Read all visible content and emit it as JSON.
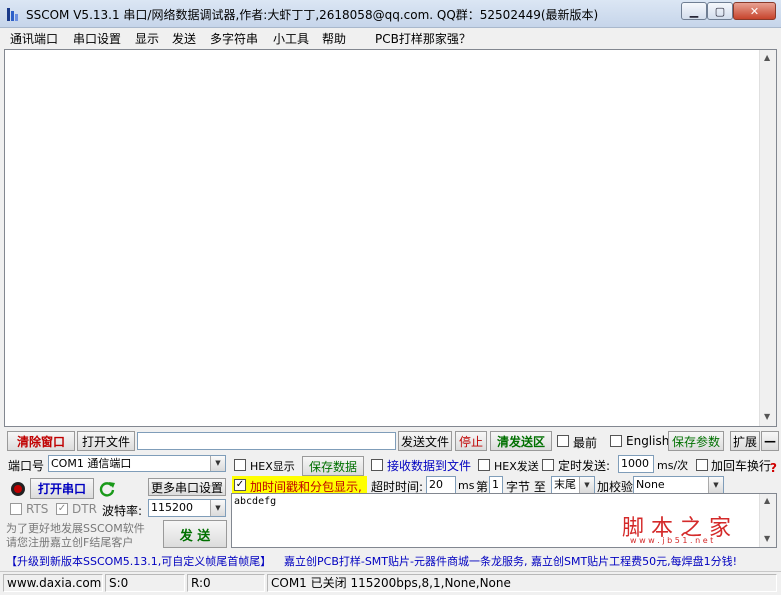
{
  "window": {
    "title": "SSCOM V5.13.1 串口/网络数据调试器,作者:大虾丁丁,2618058@qq.com. QQ群：52502449(最新版本)",
    "minimize": "▁",
    "maximize": "▢",
    "close": "✕"
  },
  "menu": [
    "通讯端口",
    "串口设置",
    "显示",
    "发送",
    "多字符串",
    "小工具",
    "帮助",
    "PCB打样那家强？"
  ],
  "receive": {
    "text": ""
  },
  "toolbar": {
    "clear_window": "清除窗口",
    "open_file": "打开文件",
    "file_path": "",
    "send_file": "发送文件",
    "stop": "停止",
    "clear_send": "清发送区",
    "topmost": "最前",
    "english": "English",
    "save_params": "保存参数",
    "expand": "扩展",
    "collapse": "—"
  },
  "port": {
    "label": "端口号",
    "value": "COM1 通信端口",
    "open_button": "打开串口",
    "more_settings": "更多串口设置",
    "rts": "RTS",
    "dtr": "DTR",
    "baud_label": "波特率:",
    "baud_value": "115200"
  },
  "options": {
    "hex_display": "HEX显示",
    "save_data": "保存数据",
    "recv_to_file": "接收数据到文件",
    "hex_send": "HEX发送",
    "timed_send": "定时发送:",
    "interval": "1000",
    "interval_unit": "ms/次",
    "add_crlf": "加回车换行",
    "help_mark": "?",
    "timestamp": "加时间戳和分包显示,",
    "timeout_label": "超时时间:",
    "timeout_value": "20",
    "timeout_unit": "ms",
    "byte_label_1": "第",
    "byte_index": "1",
    "byte_label_2": "字节 至",
    "byte_end": "末尾",
    "checksum_label": "加校验",
    "checksum_value": "None"
  },
  "promo": {
    "line1": "为了更好地发展SSCOM软件",
    "line2": "请您注册嘉立创F结尾客户",
    "send_button": "发 送"
  },
  "send": {
    "text": "abcdefg"
  },
  "watermark": {
    "cn": "脚 本 之 家",
    "url": "w w w . j b 5 1 . n e t"
  },
  "ticker": {
    "left": "【升级到新版本SSCOM5.13.1,可自定义帧尾首帧尾】",
    "right": "嘉立创PCB打样-SMT贴片-元器件商城一条龙服务, 嘉立创SMT贴片工程费50元,每焊盘1分钱!"
  },
  "status": {
    "site": "www.daxia.com",
    "sent": "S:0",
    "received": "R:0",
    "port_state": "COM1 已关闭  115200bps,8,1,None,None"
  },
  "colors": {
    "accent_red": "#c00000",
    "accent_green": "#007000",
    "highlight": "#ffff00",
    "watermark_red": "#d42a2a",
    "ticker_blue": "#0000c0"
  }
}
